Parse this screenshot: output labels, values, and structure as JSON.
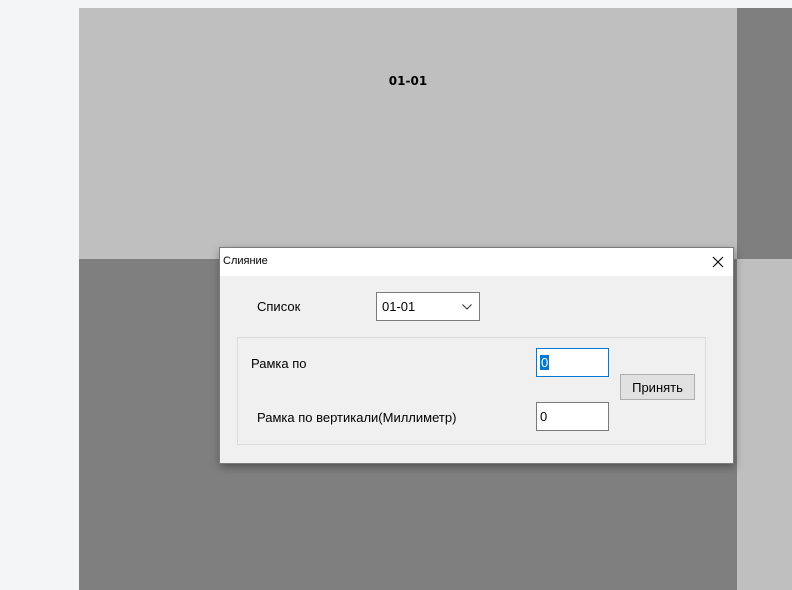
{
  "canvas": {
    "tile_label": "01-01"
  },
  "dialog": {
    "title": "Слияние",
    "close_icon": "close-icon",
    "list_label": "Список",
    "list_select": {
      "value": "01-01",
      "icon": "chevron-down-icon"
    },
    "frame_label": "Рамка по",
    "frame_value": "0",
    "frame_vertical_label": "Рамка по вертикали(Миллиметр)",
    "frame_vertical_value": "0",
    "apply_label": "Принять"
  },
  "colors": {
    "tile_light": "#bfbfbf",
    "tile_dark": "#7f7f7f",
    "focus_accent": "#0078d7"
  }
}
